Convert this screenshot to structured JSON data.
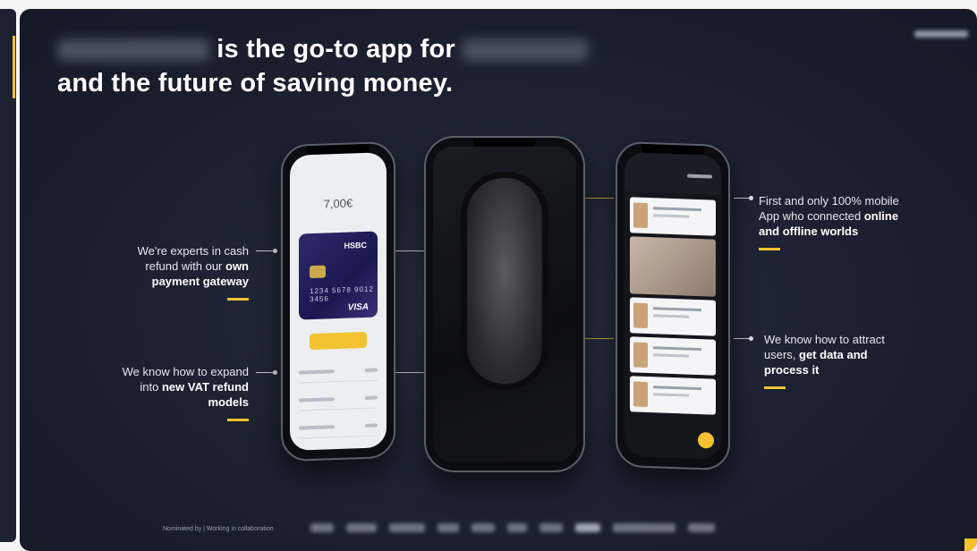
{
  "slide": {
    "headline_line1": "is the go-to app for",
    "headline_line2": "and the future of saving money."
  },
  "callouts": {
    "left_top": {
      "pre": "We're experts in cash refund with our ",
      "bold": "own payment gateway"
    },
    "left_bottom": {
      "pre": "We know how to expand into ",
      "bold": "new VAT refund models"
    },
    "right_top": {
      "pre": "First and only 100% mobile App who connected ",
      "bold": "online and offline worlds"
    },
    "right_bottom": {
      "pre": "We know how to attract users, ",
      "bold": "get data and process it"
    }
  },
  "phone_left": {
    "amount": "7,00€",
    "card_bank": "HSBC",
    "card_number": "1234 5678 9012 3456",
    "card_brand": "VISA"
  },
  "footer": {
    "note": "Nominated by | Working in collaboration"
  },
  "colors": {
    "accent": "#f2c230",
    "background": "#1c2231"
  }
}
